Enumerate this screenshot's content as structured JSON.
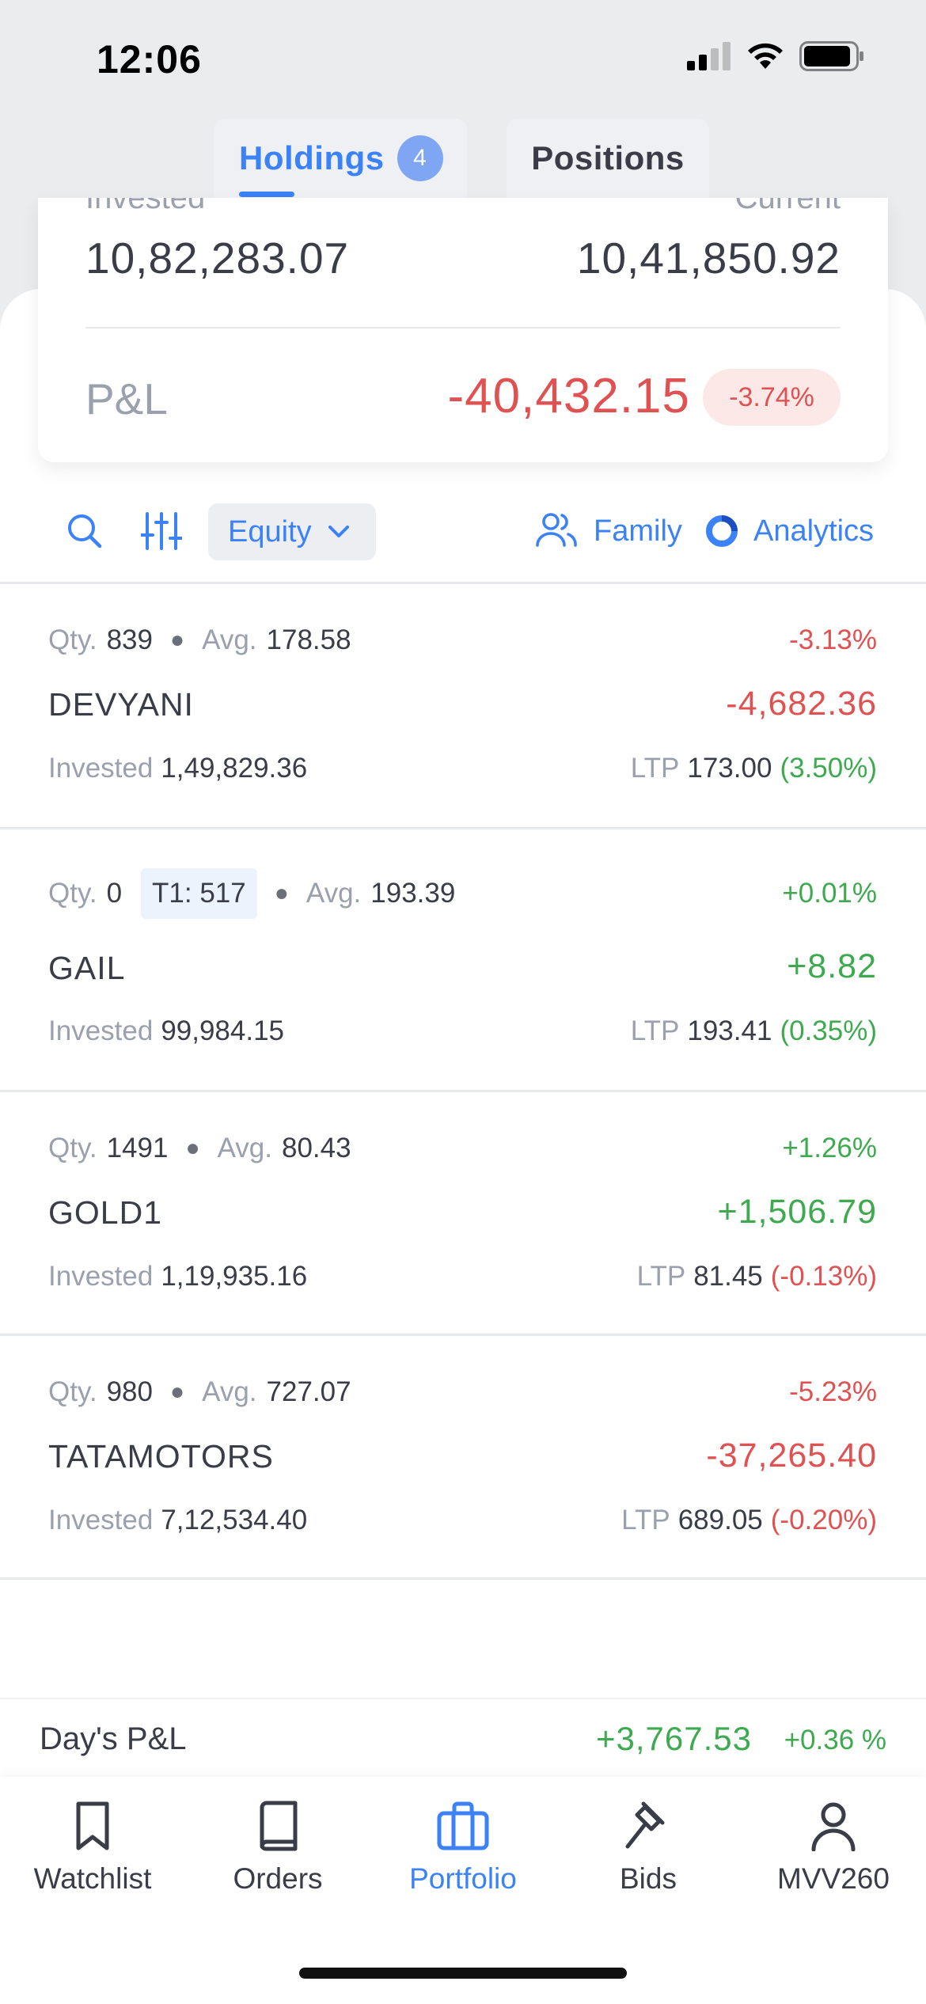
{
  "status_bar": {
    "time": "12:06"
  },
  "tabs": [
    {
      "label": "Holdings",
      "badge": "4",
      "active": true
    },
    {
      "label": "Positions",
      "active": false
    }
  ],
  "summary": {
    "invested_label": "Invested",
    "invested_value": "10,82,283.07",
    "current_label": "Current",
    "current_value": "10,41,850.92",
    "pnl_label": "P&L",
    "pnl_value": "-40,432.15",
    "pnl_percent": "-3.74%"
  },
  "toolbar": {
    "filter_label": "Equity",
    "family_label": "Family",
    "analytics_label": "Analytics"
  },
  "labels": {
    "qty": "Qty.",
    "avg": "Avg.",
    "invested": "Invested",
    "ltp": "LTP",
    "t1": "T1: 517"
  },
  "holdings": [
    {
      "qty": "839",
      "avg": "178.58",
      "pct": "-3.13%",
      "name": "DEVYANI",
      "pnl": "-4,682.36",
      "invested": "1,49,829.36",
      "ltp": "173.00",
      "change": "(3.50%)"
    },
    {
      "qty": "0",
      "avg": "193.39",
      "pct": "+0.01%",
      "name": "GAIL",
      "pnl": "+8.82",
      "invested": "99,984.15",
      "ltp": "193.41",
      "change": "(0.35%)"
    },
    {
      "qty": "1491",
      "avg": "80.43",
      "pct": "+1.26%",
      "name": "GOLD1",
      "pnl": "+1,506.79",
      "invested": "1,19,935.16",
      "ltp": "81.45",
      "change": "(-0.13%)"
    },
    {
      "qty": "980",
      "avg": "727.07",
      "pct": "-5.23%",
      "name": "TATAMOTORS",
      "pnl": "-37,265.40",
      "invested": "7,12,534.40",
      "ltp": "689.05",
      "change": "(-0.20%)"
    }
  ],
  "day_pnl": {
    "label": "Day's P&L",
    "value": "+3,767.53",
    "percent": "+0.36 %"
  },
  "nav": [
    {
      "label": "Watchlist",
      "icon": "bookmark-icon"
    },
    {
      "label": "Orders",
      "icon": "book-icon"
    },
    {
      "label": "Portfolio",
      "icon": "briefcase-icon",
      "active": true
    },
    {
      "label": "Bids",
      "icon": "gavel-icon"
    },
    {
      "label": "MVV260",
      "icon": "user-icon"
    }
  ],
  "colors": {
    "accent": "#3b82f6",
    "loss": "#e05252",
    "gain": "#3daa4f",
    "muted": "#9aa0ad"
  }
}
